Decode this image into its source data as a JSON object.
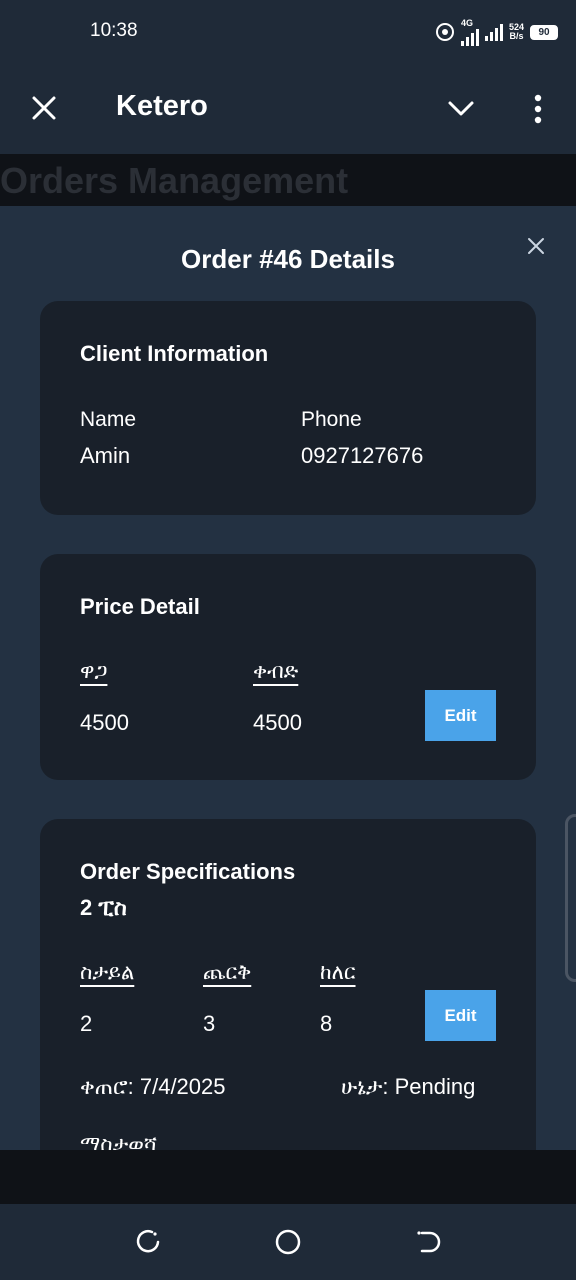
{
  "status_bar": {
    "time": "10:38",
    "network": "4G",
    "speed_value": "524",
    "speed_unit": "B/s",
    "battery": "90"
  },
  "app_bar": {
    "title": "Ketero",
    "close_icon": "close-icon",
    "chevron_icon": "chevron-down-icon",
    "more_icon": "more-vert-icon"
  },
  "page": {
    "heading": "Orders Management"
  },
  "modal": {
    "title": "Order #46 Details",
    "client": {
      "title": "Client Information",
      "name_label": "Name",
      "name_value": "Amin",
      "phone_label": "Phone",
      "phone_value": "0927127676"
    },
    "price": {
      "title": "Price Detail",
      "price_label": "ዋጋ",
      "price_value": "4500",
      "deposit_label": "ቀብድ",
      "deposit_value": "4500",
      "edit_label": "Edit"
    },
    "specs": {
      "title": "Order Specifications",
      "subtitle": "2 ፒስ",
      "style_label": "ስታይል",
      "style_value": "2",
      "fabric_label": "ጨርቅ",
      "fabric_value": "3",
      "color_label": "ከለር",
      "color_value": "8",
      "edit_label": "Edit",
      "date_text": "ቀጠሮ: 7/4/2025",
      "status_text": "ሁኔታ: Pending",
      "note_label": "ማስታወሻ"
    }
  },
  "colors": {
    "background": "#1f2a38",
    "modal": "#233142",
    "card": "#19202a",
    "accent": "#4aa3e9"
  }
}
